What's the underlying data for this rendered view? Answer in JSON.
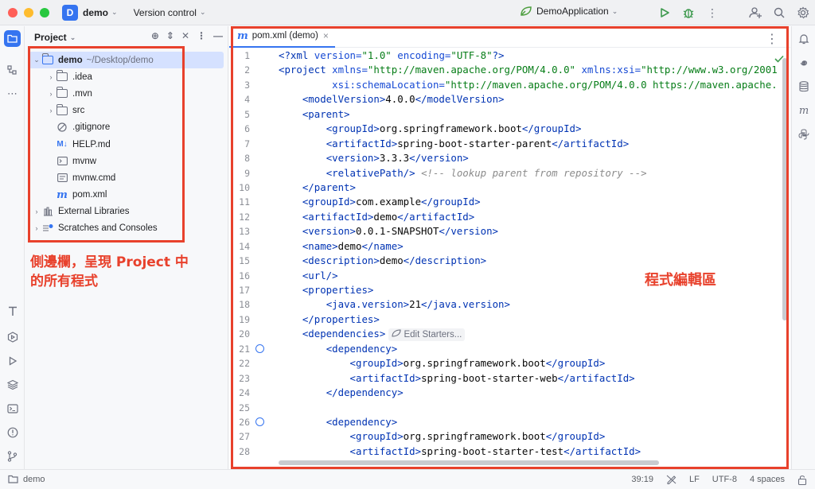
{
  "titlebar": {
    "project_badge": "D",
    "project_name": "demo",
    "version_control": "Version control",
    "run_config": "DemoApplication"
  },
  "project_panel": {
    "title": "Project",
    "root": {
      "name": "demo",
      "path": "~/Desktop/demo"
    },
    "items": [
      {
        "label": ".idea",
        "icon": "folder-icon"
      },
      {
        "label": ".mvn",
        "icon": "folder-icon"
      },
      {
        "label": "src",
        "icon": "folder-icon"
      },
      {
        "label": ".gitignore",
        "icon": "ignore-file-icon"
      },
      {
        "label": "HELP.md",
        "icon": "markdown-icon"
      },
      {
        "label": "mvnw",
        "icon": "terminal-file-icon"
      },
      {
        "label": "mvnw.cmd",
        "icon": "text-file-icon"
      },
      {
        "label": "pom.xml",
        "icon": "maven-icon"
      },
      {
        "label": "External Libraries",
        "icon": "libraries-icon"
      },
      {
        "label": "Scratches and Consoles",
        "icon": "scratches-icon"
      }
    ]
  },
  "annotations": {
    "sidebar_line1": "側邊欄，呈現 Project 中",
    "sidebar_line2": "的所有程式",
    "editor": "程式編輯區"
  },
  "editor": {
    "tab_label": "pom.xml (demo)",
    "hint_label": "Edit Starters...",
    "line_numbers": [
      "1",
      "2",
      "3",
      "4",
      "5",
      "6",
      "7",
      "8",
      "9",
      "10",
      "11",
      "12",
      "13",
      "14",
      "15",
      "16",
      "17",
      "18",
      "19",
      "20",
      "21",
      "22",
      "23",
      "24",
      "25",
      "26",
      "27",
      "28"
    ]
  },
  "status": {
    "project": "demo",
    "position": "39:19",
    "line_ending": "LF",
    "encoding": "UTF-8",
    "indent": "4 spaces"
  },
  "colors": {
    "accent": "#3574f0",
    "annotation": "#e8412c"
  }
}
